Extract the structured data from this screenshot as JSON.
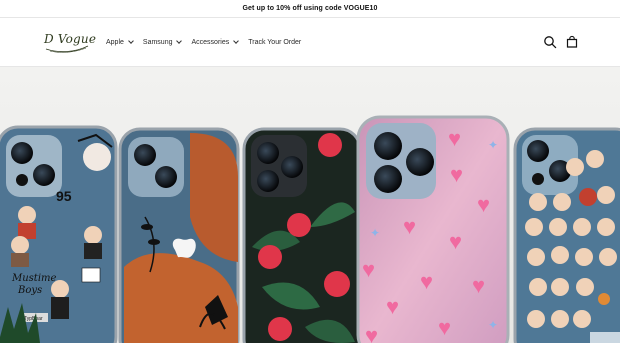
{
  "announcement": {
    "text": "Get up to 10% off using code VOGUE10"
  },
  "header": {
    "logo_text": "D Vogue",
    "nav": [
      {
        "label": "Apple",
        "has_dropdown": true
      },
      {
        "label": "Samsung",
        "has_dropdown": true
      },
      {
        "label": "Accessories",
        "has_dropdown": true
      },
      {
        "label": "Track Your Order",
        "has_dropdown": false
      }
    ],
    "icons": [
      "search-icon",
      "cart-icon"
    ]
  },
  "hero": {
    "case_texts": {
      "number": "95",
      "mustime_line1": "Mustime",
      "mustime_line2": "Boys",
      "tag": "TypBoar"
    }
  },
  "colors": {
    "accent": "#121212",
    "case_blue": "#4a6f8c",
    "case_pink": "#d9a3c0",
    "case_dark": "#1c2b24",
    "hibiscus": "#e0364a"
  }
}
